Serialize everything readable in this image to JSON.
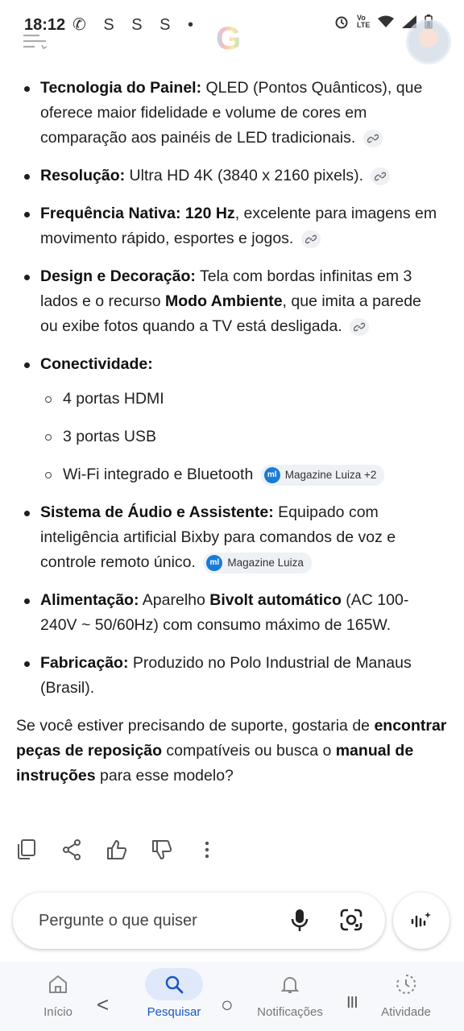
{
  "status": {
    "time": "18:12",
    "left_icons": "✆ S S S •",
    "right_icons": [
      "alarm-icon",
      "volte-icon",
      "wifi-icon",
      "signal-icon",
      "battery-icon"
    ]
  },
  "bullets": [
    {
      "label": "Tecnologia do Painel:",
      "text": " QLED (Pontos Quânticos), que oferece maior fidelidade e volume de cores em comparação aos painéis de LED tradicionais."
    },
    {
      "label": "Resolução:",
      "text": " Ultra HD 4K (3840 x 2160 pixels)."
    },
    {
      "label": "Frequência Nativa: 120 Hz",
      "text": ", excelente para imagens em movimento rápido, esportes e jogos."
    },
    {
      "label": "Design e Decoração:",
      "text": " Tela com bordas infinitas em 3 lados e o recurso ",
      "bold2": "Modo Ambiente",
      "text2": ", que imita a parede ou exibe fotos quando a TV está desligada."
    },
    {
      "label": "Conectividade:",
      "sub": [
        "4 portas HDMI",
        "3 portas USB",
        "Wi-Fi integrado e Bluetooth"
      ],
      "source": "Magazine Luiza +2"
    },
    {
      "label": "Sistema de Áudio e Assistente:",
      "text": " Equipado com inteligência artificial Bixby para comandos de voz e controle remoto único.",
      "source": "Magazine Luiza"
    },
    {
      "label": "Alimentação:",
      "text": " Aparelho ",
      "bold2": "Bivolt automático",
      "text2": " (AC 100-240V ~ 50/60Hz) com consumo máximo de 165W."
    },
    {
      "label": "Fabricação:",
      "text": " Produzido no Polo Industrial de Manaus (Brasil)."
    }
  ],
  "source_logo": "ml",
  "closing": {
    "t1": "Se você estiver precisando de suporte, gostaria de ",
    "b1": "encontrar peças de reposição",
    "t2": " compatíveis ou busca o ",
    "b2": "manual de instruções",
    "t3": " para esse modelo?"
  },
  "input": {
    "placeholder": "Pergunte o que quiser"
  },
  "nav": [
    {
      "label": "Início",
      "icon": "home-icon"
    },
    {
      "label": "Pesquisar",
      "icon": "search-icon"
    },
    {
      "label": "Notificações",
      "icon": "bell-icon"
    },
    {
      "label": "Atividade",
      "icon": "activity-icon"
    }
  ],
  "system_nav": {
    "back": "<",
    "home": "○",
    "recents": "III"
  },
  "colors": {
    "accent": "#1a56c4",
    "chip_bg": "#eef1f5",
    "source_icon": "#1a7bd6"
  }
}
